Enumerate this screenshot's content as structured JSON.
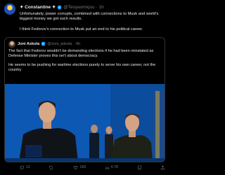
{
  "tweet": {
    "author_name": "✦ Constantine ✦",
    "handle": "@Teoyaomiquu",
    "time": "· 1h",
    "text_1": "Unfortunately, power corrupts, combined with connections to Musk and world's biggest money we get such results.",
    "text_2": "I think Fedorov's connection to Musk put an end to his political career."
  },
  "quote": {
    "author_name": "Joni Askola",
    "handle": "@Joni_askola",
    "time": "· 9h",
    "text_1": "The fact that Fedorov wouldn't be demanding elections if he had been reinstated as Defense Minister proves this isn't about democracy.",
    "text_2": "He seems to be pushing for wartime elections purely to serve his own career, not the country"
  },
  "actions": {
    "replies": "12",
    "retweets": "",
    "likes": "165",
    "views": "4.7K"
  },
  "colors": {
    "background": "#000000",
    "text": "#e7e9ea",
    "muted": "#71767b",
    "verified": "#1d9bf0",
    "photo_blue": "#0d58b3"
  }
}
